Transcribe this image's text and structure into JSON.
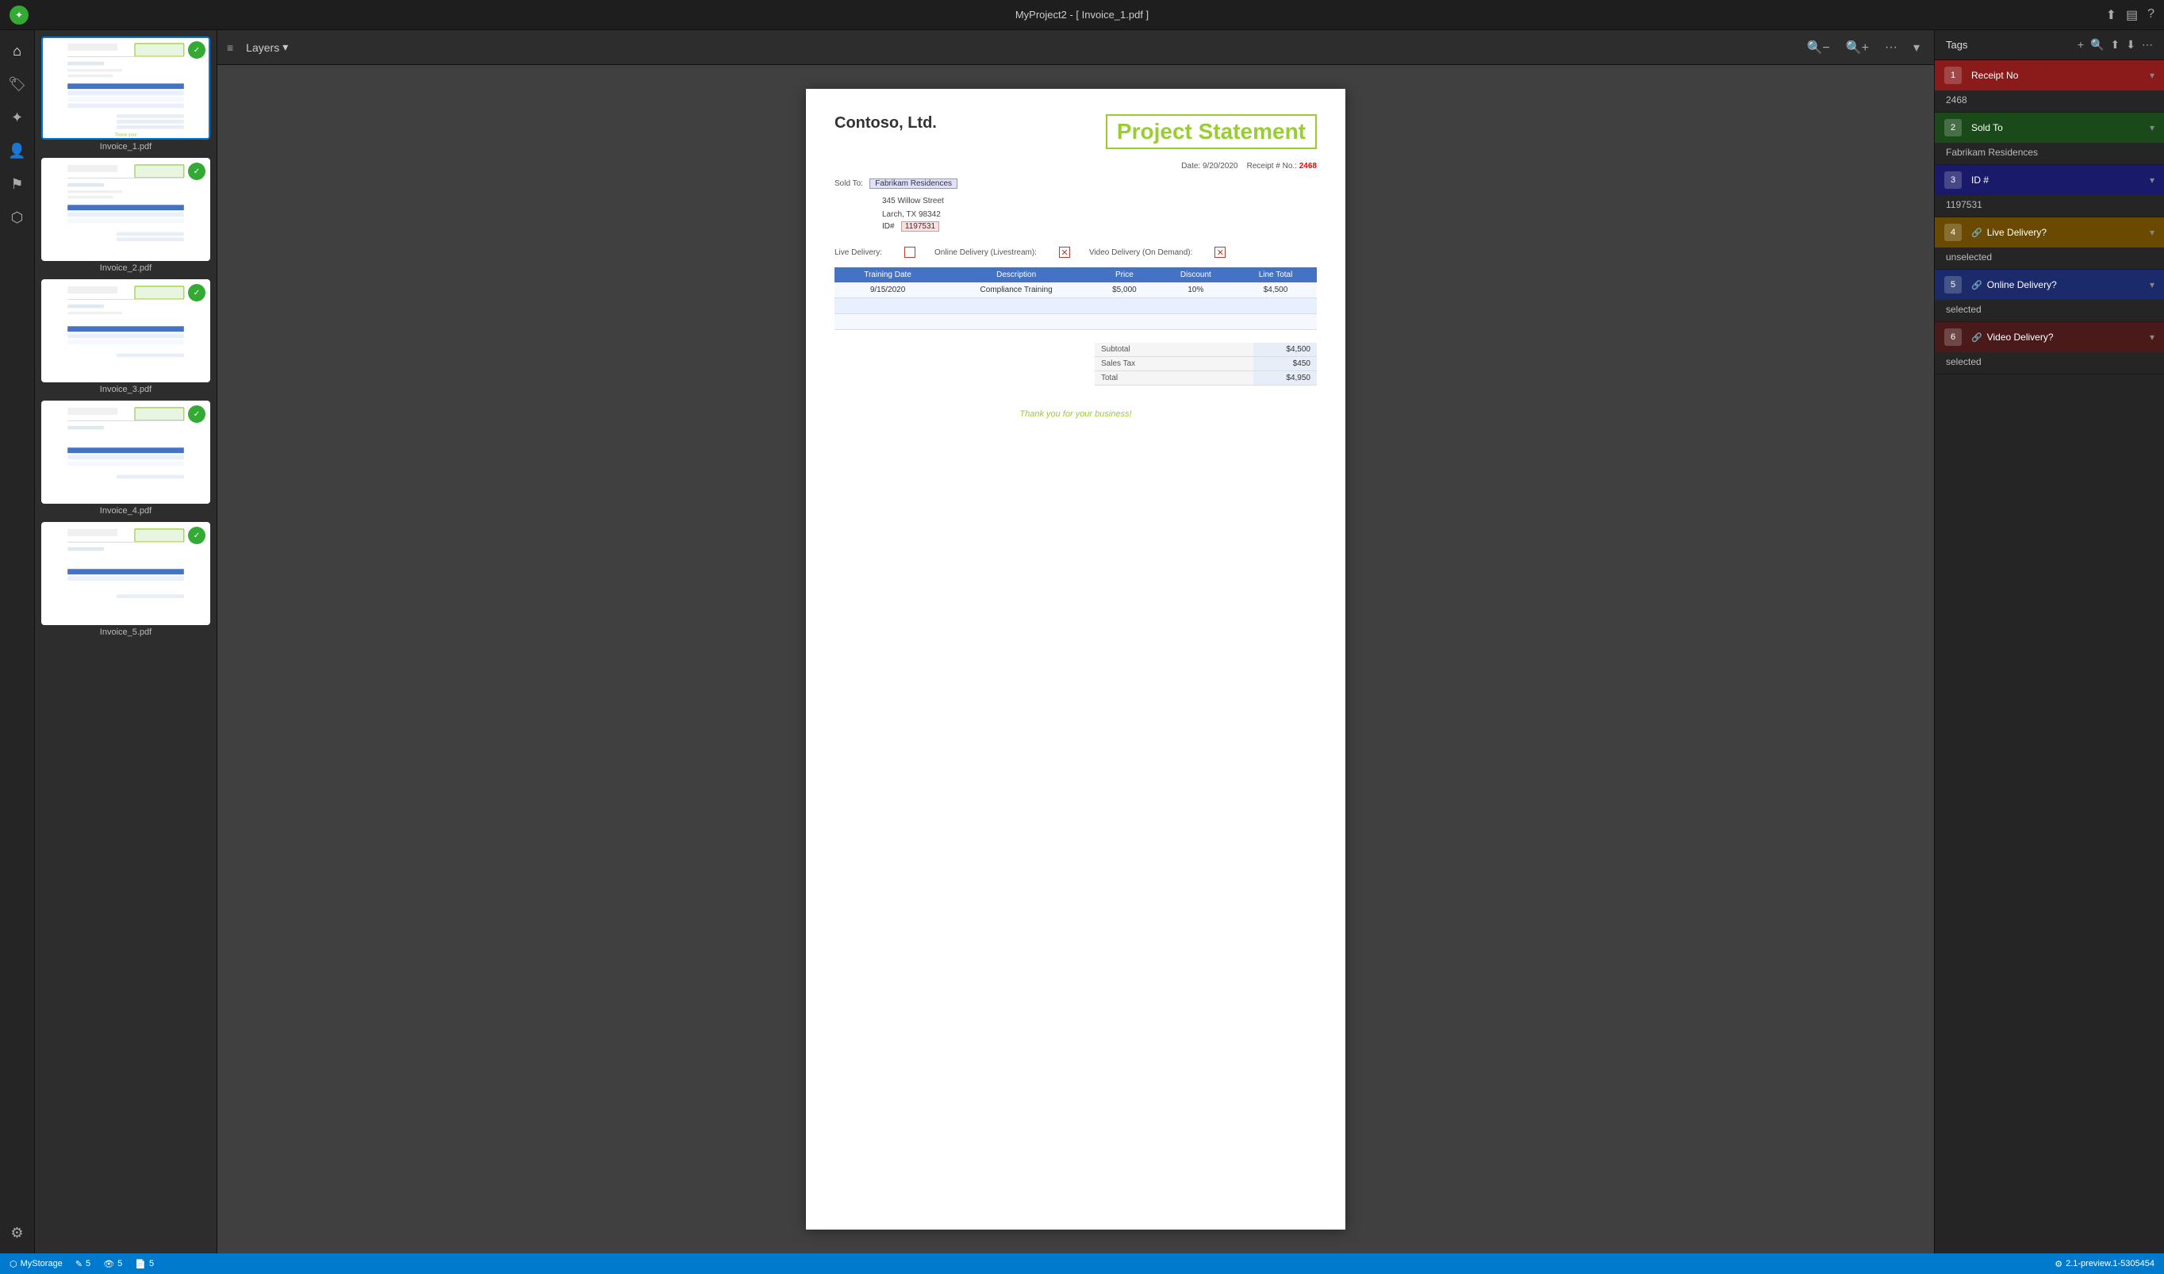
{
  "titlebar": {
    "title": "MyProject2 - [ Invoice_1.pdf ]"
  },
  "toolbar": {
    "layers_label": "Layers",
    "zoom_out": "−",
    "zoom_in": "+",
    "more": "···"
  },
  "sidebar_icons": [
    {
      "name": "home-icon",
      "glyph": "⌂"
    },
    {
      "name": "bookmark-icon",
      "glyph": "🔖"
    },
    {
      "name": "star-icon",
      "glyph": "✦"
    },
    {
      "name": "person-icon",
      "glyph": "👤"
    },
    {
      "name": "flag-icon",
      "glyph": "⚑"
    },
    {
      "name": "puzzle-icon",
      "glyph": "⬡"
    },
    {
      "name": "settings-icon",
      "glyph": "⚙"
    }
  ],
  "thumbnails": [
    {
      "label": "Invoice_1.pdf",
      "active": true,
      "badge": true
    },
    {
      "label": "Invoice_2.pdf",
      "active": false,
      "badge": true
    },
    {
      "label": "Invoice_3.pdf",
      "active": false,
      "badge": true
    },
    {
      "label": "Invoice_4.pdf",
      "active": false,
      "badge": true
    },
    {
      "label": "Invoice_5.pdf",
      "active": false,
      "badge": true
    }
  ],
  "invoice": {
    "company": "Contoso, Ltd.",
    "title": "Project Statement",
    "date_label": "Date:",
    "date_value": "9/20/2020",
    "receipt_label": "Receipt # No.:",
    "receipt_value": "2468",
    "sold_to_label": "Sold To:",
    "sold_to_value": "Fabrikam Residences",
    "address_line1": "345 Willow Street",
    "address_line2": "Larch, TX 98342",
    "id_label": "ID#",
    "id_value": "1197531",
    "live_delivery_label": "Live Delivery:",
    "live_checked": false,
    "online_delivery_label": "Online Delivery (Livestream):",
    "online_checked": true,
    "video_delivery_label": "Video Delivery (On Demand):",
    "video_checked": true,
    "table": {
      "headers": [
        "Training Date",
        "Description",
        "Price",
        "Discount",
        "Line Total"
      ],
      "rows": [
        {
          "date": "9/15/2020",
          "description": "Compliance Training",
          "price": "$5,000",
          "discount": "10%",
          "line_total": "$4,500"
        },
        {
          "date": "",
          "description": "",
          "price": "",
          "discount": "",
          "line_total": ""
        },
        {
          "date": "",
          "description": "",
          "price": "",
          "discount": "",
          "line_total": ""
        }
      ]
    },
    "subtotal_label": "Subtotal",
    "subtotal_value": "$4,500",
    "sales_tax_label": "Sales Tax",
    "sales_tax_value": "$450",
    "total_label": "Total",
    "total_value": "$4,950",
    "thank_you": "Thank you for your business!"
  },
  "tags": {
    "panel_title": "Tags",
    "add_icon": "+",
    "search_icon": "🔍",
    "groups": [
      {
        "id": "receipt-no",
        "label": "Receipt No",
        "number": "1",
        "color_class": "tag-g1",
        "value": "2468",
        "has_link": false
      },
      {
        "id": "sold-to",
        "label": "Sold To",
        "number": "2",
        "color_class": "tag-g2",
        "value": "Fabrikam Residences",
        "has_link": false
      },
      {
        "id": "id-hash",
        "label": "ID #",
        "number": "3",
        "color_class": "tag-g3",
        "value": "1197531",
        "has_link": false
      },
      {
        "id": "live-delivery",
        "label": "Live Delivery?",
        "number": "4",
        "color_class": "tag-g4",
        "value": "unselected",
        "has_link": true
      },
      {
        "id": "online-delivery",
        "label": "Online Delivery?",
        "number": "5",
        "color_class": "tag-g5",
        "value": "selected",
        "has_link": true
      },
      {
        "id": "video-delivery",
        "label": "Video Delivery?",
        "number": "6",
        "color_class": "tag-g6",
        "value": "selected",
        "has_link": true
      }
    ]
  },
  "statusbar": {
    "storage_label": "MyStorage",
    "count1": "5",
    "count2": "5",
    "count3": "5",
    "version": "2.1-preview.1-5305454"
  }
}
